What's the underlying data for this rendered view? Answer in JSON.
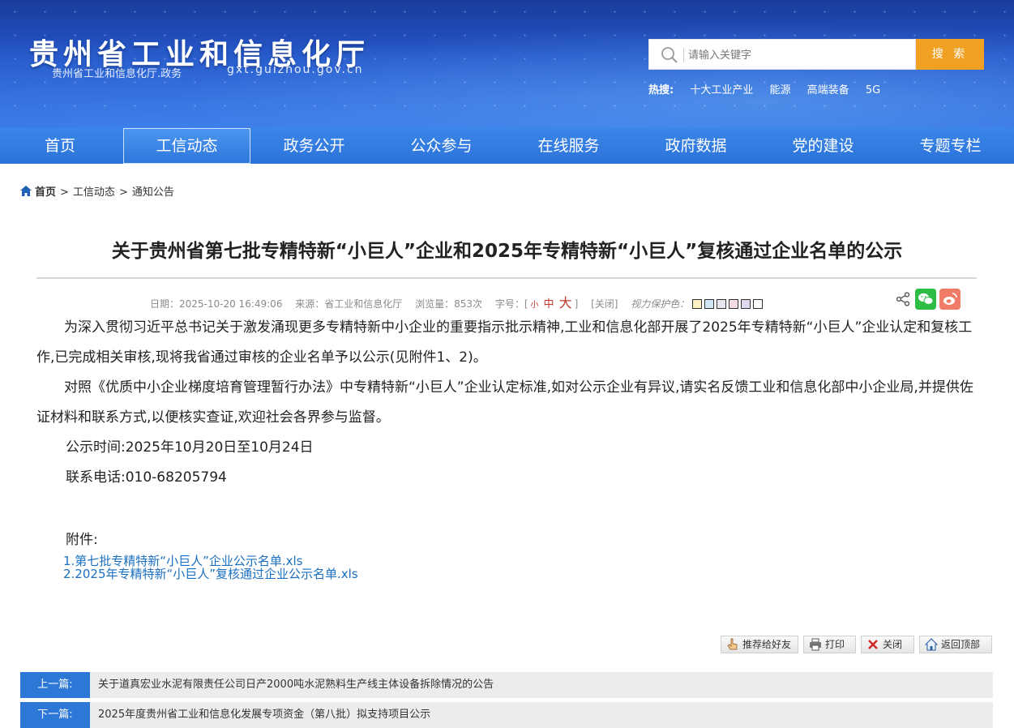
{
  "header": {
    "title": "贵州省工业和信息化厅",
    "subtitle": "贵州省工业和信息化厅.政务",
    "domain": "gxt.guizhou.gov.cn"
  },
  "search": {
    "placeholder": "请输入关键字",
    "button_label": "搜 索",
    "hot_label": "热搜:",
    "hot_items": [
      "十大工业产业",
      "能源",
      "高端装备",
      "5G"
    ]
  },
  "nav": {
    "items": [
      "首页",
      "工信动态",
      "政务公开",
      "公众参与",
      "在线服务",
      "政府数据",
      "党的建设",
      "专题专栏"
    ],
    "active_index": 1
  },
  "breadcrumb": {
    "home": "首页",
    "level1": "工信动态",
    "level2": "通知公告",
    "separator": ">"
  },
  "article": {
    "title": "关于贵州省第七批专精特新“小巨人”企业和2025年专精特新“小巨人”复核通过企业名单的公示",
    "meta": {
      "date": "日期：2025-10-20 16:49:06",
      "source": "来源：省工业和信息化厅",
      "views": "浏览量：853次",
      "font_size_label": "字号：[",
      "font_small": "小",
      "font_medium": "中",
      "font_large": "大",
      "font_close_bracket": "]",
      "close": "[关闭]",
      "eye_protect": "视力保护色：",
      "swatch_colors": [
        "#fbf2c4",
        "#cfe6f5",
        "#e6e6f0",
        "#f5dbe3",
        "#e2d8f2",
        "#ffffff"
      ]
    },
    "paragraphs": [
      "为深入贯彻习近平总书记关于激发涌现更多专精特新中小企业的重要指示批示精神,工业和信息化部开展了2025年专精特新“小巨人”企业认定和复核工作,已完成相关审核,现将我省通过审核的企业名单予以公示(见附件1、2)。",
      "对照《优质中小企业梯度培育管理暂行办法》中专精特新“小巨人”企业认定标准,如对公示企业有异议,请实名反馈工业和信息化部中小企业局,并提供佐证材料和联系方式,以便核实查证,欢迎社会各界参与监督。"
    ],
    "publicity_time": "公示时间:2025年10月20日至10月24日",
    "phone": "联系电话:010-68205794",
    "attachment_label": "附件:",
    "attachments": [
      "1.第七批专精特新“小巨人”企业公示名单.xls",
      "2.2025年专精特新“小巨人”复核通过企业公示名单.xls"
    ]
  },
  "tools": {
    "recommend": "推荐给好友",
    "print": "打印",
    "close": "关闭",
    "top": "返回顶部"
  },
  "prev_next": {
    "prev_label": "上一篇:",
    "prev_title": "关于道真宏业水泥有限责任公司日产2000吨水泥熟料生产线主体设备拆除情况的公告",
    "next_label": "下一篇:",
    "next_title": "2025年度贵州省工业和信息化发展专项资金（第八批）拟支持项目公示"
  },
  "colors": {
    "nav_bg": "#2c73d9",
    "search_button": "#f0a022",
    "link": "#1a6fc0",
    "prev_next_label": "#2d78d6"
  }
}
